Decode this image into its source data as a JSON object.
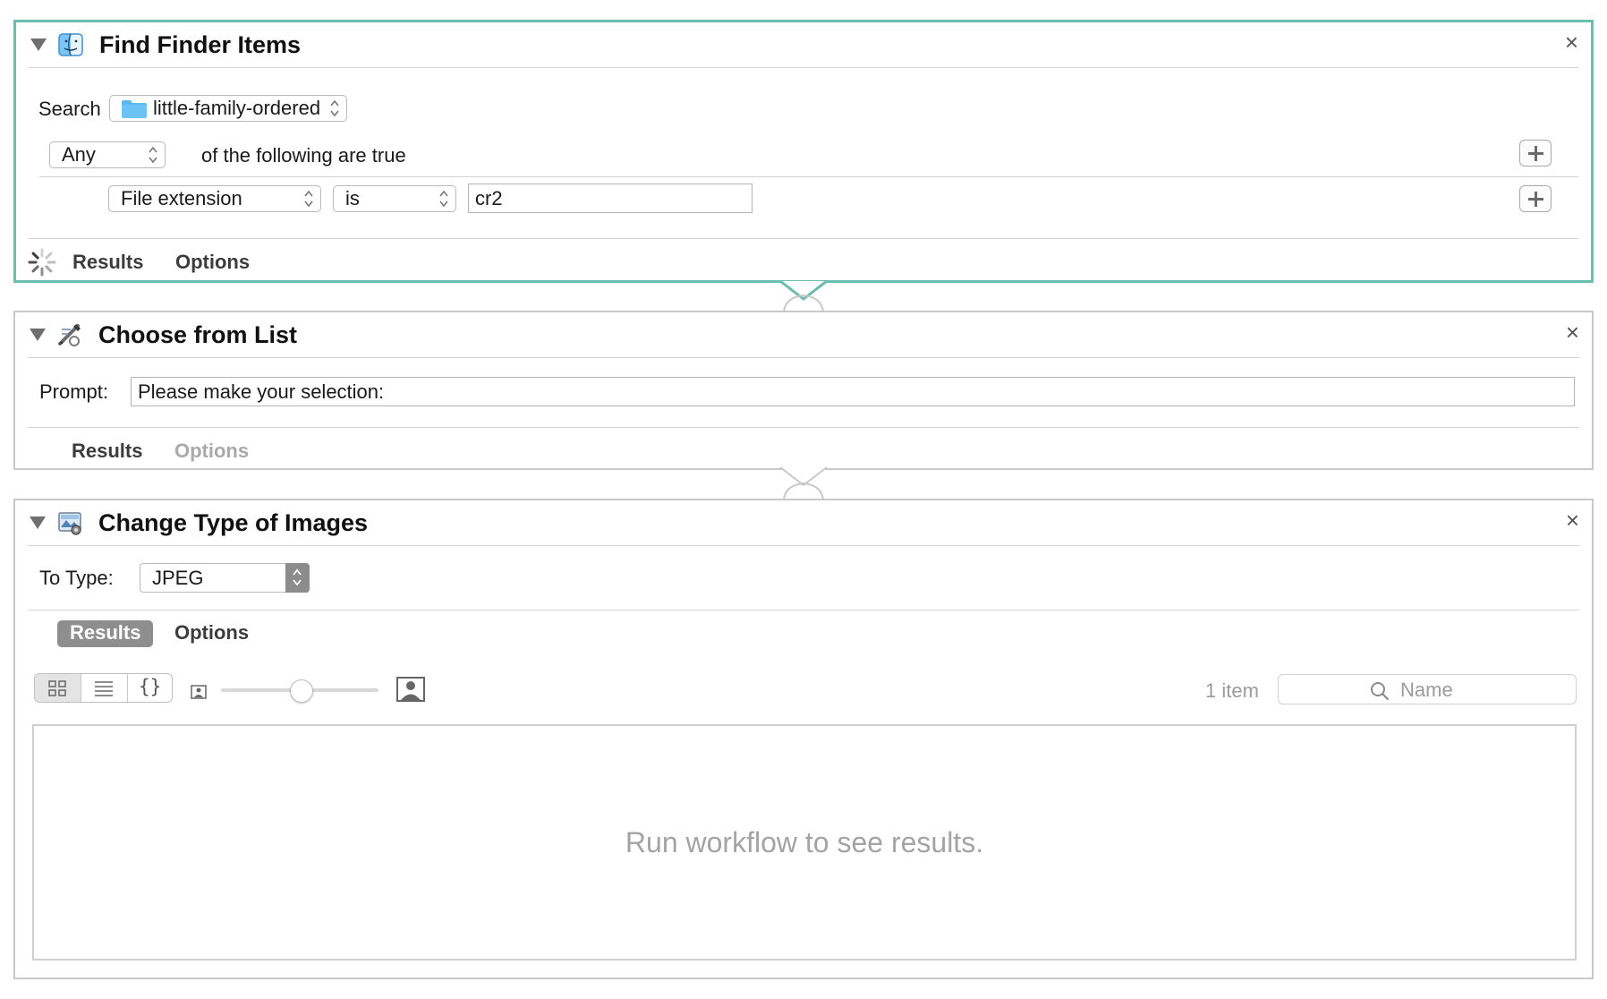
{
  "actions": [
    {
      "title": "Find Finder Items",
      "search_label": "Search",
      "search_folder": "little-family-ordered",
      "match_mode": "Any",
      "match_suffix": "of the following are true",
      "criterion": {
        "field": "File extension",
        "operator": "is",
        "value": "cr2"
      },
      "tabs": {
        "results": "Results",
        "options": "Options"
      },
      "close": "×"
    },
    {
      "title": "Choose from List",
      "prompt_label": "Prompt:",
      "prompt_value": "Please make your selection:",
      "tabs": {
        "results": "Results",
        "options": "Options"
      },
      "close": "×"
    },
    {
      "title": "Change Type of Images",
      "to_type_label": "To Type:",
      "to_type_value": "JPEG",
      "tabs": {
        "results": "Results",
        "options": "Options"
      },
      "item_count": "1 item",
      "search_placeholder": "Name",
      "empty_message": "Run workflow to see results.",
      "view_braces": "{}",
      "close": "×"
    }
  ],
  "colors": {
    "selected_border": "#6cbcb0",
    "card_border": "#c8c8c8",
    "active_tab_bg": "#8e8e8e",
    "folder_blue": "#5bb8f0"
  }
}
